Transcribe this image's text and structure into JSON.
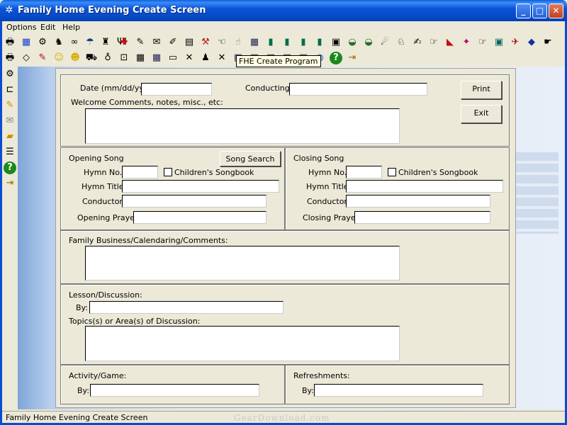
{
  "window": {
    "title": "Family Home Evening Create Screen",
    "min": "_",
    "max": "□",
    "close": "✕"
  },
  "menu": {
    "options": "Options",
    "edit": "Edit",
    "help": "Help"
  },
  "toolbar": {
    "row1_icons": [
      "printer-icon",
      "flag-icon",
      "gear-icon",
      "horse-icon",
      "binoculars-icon",
      "umbrella-icon",
      "temple-icon",
      "utensils-icon",
      "first-aid-icon",
      "edit-icon",
      "envelope-icon",
      "pencil-icon",
      "calendar-icon",
      "tools-icon",
      "hand-icon",
      "hand-icon",
      "calendar-grid-icon",
      "book-icon",
      "book-icon",
      "book-icon",
      "book-icon",
      "calculator-icon",
      "shoe-icon",
      "shoe-icon",
      "owl-icon",
      "horse-icon",
      "writing-icon",
      "pointer-icon",
      "book-icon",
      "bird-icon",
      "pointer-icon",
      "picture-icon",
      "airplane-icon",
      "eraser-icon",
      "hand-icon"
    ],
    "row2_icons": [
      "printer-icon",
      "eraser-icon",
      "paint-icon",
      "smiley-icon",
      "smiley-icon",
      "cart-icon",
      "bell-icon",
      "lock-icon",
      "grid-icon",
      "grid-icon",
      "book-icon",
      "cross-icon",
      "person-icon",
      "cross-icon",
      "grid-icon",
      "grid-icon",
      "grid-icon",
      "grid-icon",
      "grid-icon",
      "globe-icon",
      "help-icon",
      "exit-icon"
    ],
    "tooltip": "FHE Create Program"
  },
  "left_toolbar": {
    "icons": [
      "gears-icon",
      "folder-icon",
      "pencil-icon",
      "envelope-icon",
      "folder-icon",
      "tools-icon",
      "help-icon",
      "exit-icon"
    ]
  },
  "form": {
    "date_label": "Date (mm/dd/yy):",
    "date_value": "",
    "conducting_label": "Conducting:",
    "conducting_value": "",
    "print_button": "Print",
    "exit_button": "Exit",
    "welcome_label": "Welcome Comments, notes, misc., etc:",
    "welcome_value": "",
    "opening_song": {
      "heading": "Opening Song",
      "song_search_button": "Song Search",
      "hymn_no_label": "Hymn No.:",
      "hymn_no_value": "",
      "childrens_label": "Children's Songbook",
      "hymn_title_label": "Hymn Title:",
      "hymn_title_value": "",
      "conductor_label": "Conductor:",
      "conductor_value": "",
      "prayer_label": "Opening Prayer:",
      "prayer_value": ""
    },
    "closing_song": {
      "heading": "Closing Song",
      "hymn_no_label": "Hymn No.:",
      "hymn_no_value": "",
      "childrens_label": "Children's Songbook",
      "hymn_title_label": "Hymn Title:",
      "hymn_title_value": "",
      "conductor_label": "Conductor:",
      "conductor_value": "",
      "prayer_label": "Closing Prayer:",
      "prayer_value": ""
    },
    "family_business_label": "Family Business/Calendaring/Comments:",
    "family_business_value": "",
    "lesson_label": "Lesson/Discussion:",
    "lesson_by_label": "By:",
    "lesson_by_value": "",
    "topics_label": "Topics(s) or Area(s) of Discussion:",
    "topics_value": "",
    "activity_label": "Activity/Game:",
    "activity_by_label": "By:",
    "activity_by_value": "",
    "refreshments_label": "Refreshments:",
    "refreshments_by_label": "By:",
    "refreshments_by_value": ""
  },
  "status": {
    "text": "Family Home Evening Create Screen",
    "watermark": "GearDownload.com"
  }
}
